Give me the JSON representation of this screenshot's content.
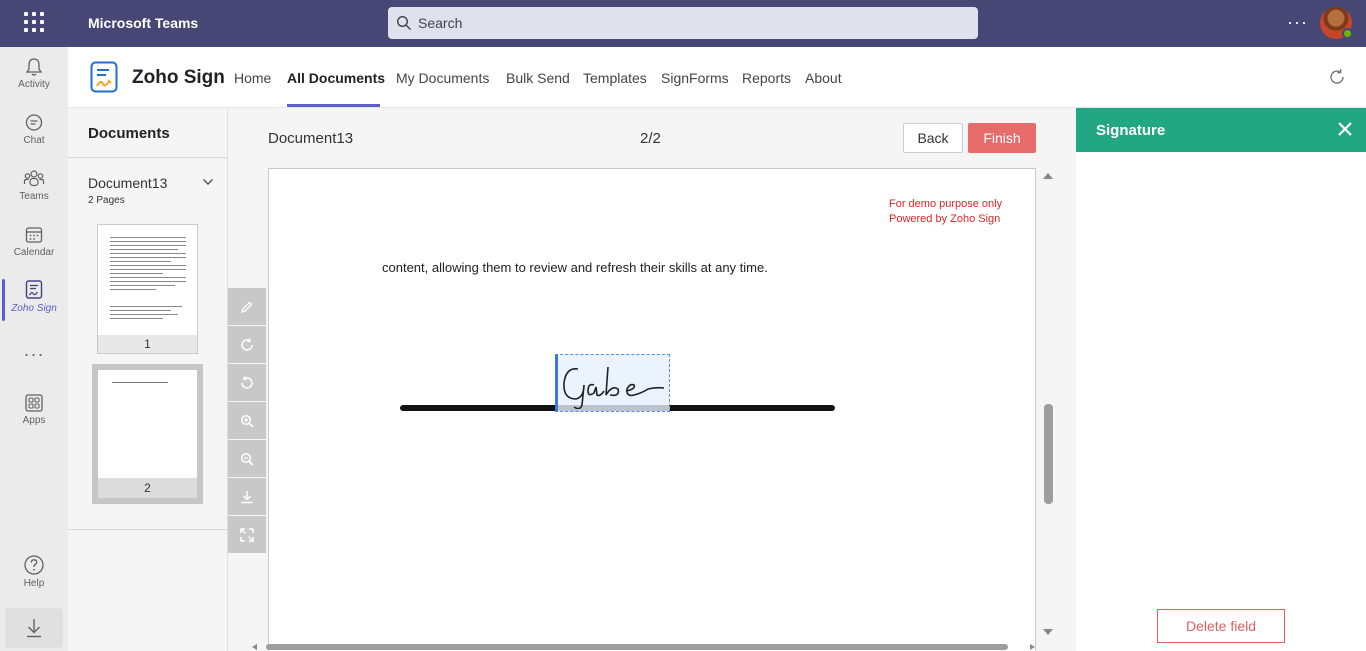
{
  "teams": {
    "app_title": "Microsoft Teams",
    "search_placeholder": "Search",
    "more": "···",
    "rail": [
      {
        "label": "Activity",
        "icon": "bell-icon"
      },
      {
        "label": "Chat",
        "icon": "chat-icon"
      },
      {
        "label": "Teams",
        "icon": "teams-icon"
      },
      {
        "label": "Calendar",
        "icon": "calendar-icon"
      },
      {
        "label": "Zoho Sign",
        "icon": "zoho-sign-icon"
      },
      {
        "label": "Apps",
        "icon": "apps-icon"
      },
      {
        "label": "Help",
        "icon": "help-icon"
      }
    ],
    "rail_more": "···"
  },
  "zoho": {
    "brand": "Zoho Sign",
    "nav": [
      "Home",
      "All Documents",
      "My Documents",
      "Bulk Send",
      "Templates",
      "SignForms",
      "Reports",
      "About"
    ],
    "active_nav": "All Documents"
  },
  "documents": {
    "title": "Documents",
    "doc_name": "Document13",
    "pages_count": "2 Pages",
    "thumbs": [
      "1",
      "2"
    ]
  },
  "viewer": {
    "doc_title": "Document13",
    "page_indicator": "2/2",
    "back_label": "Back",
    "finish_label": "Finish",
    "demo_line1": "For demo purpose only",
    "demo_line2": "Powered by Zoho Sign",
    "body_text": "content, allowing them to review and refresh their skills at any time.",
    "signature_text": "Gabe"
  },
  "signature_panel": {
    "title": "Signature",
    "delete_label": "Delete field"
  },
  "colors": {
    "teams_bar": "#464775",
    "accent": "#5b5fc7",
    "finish": "#e86b6b",
    "signature_header": "#22a783"
  }
}
